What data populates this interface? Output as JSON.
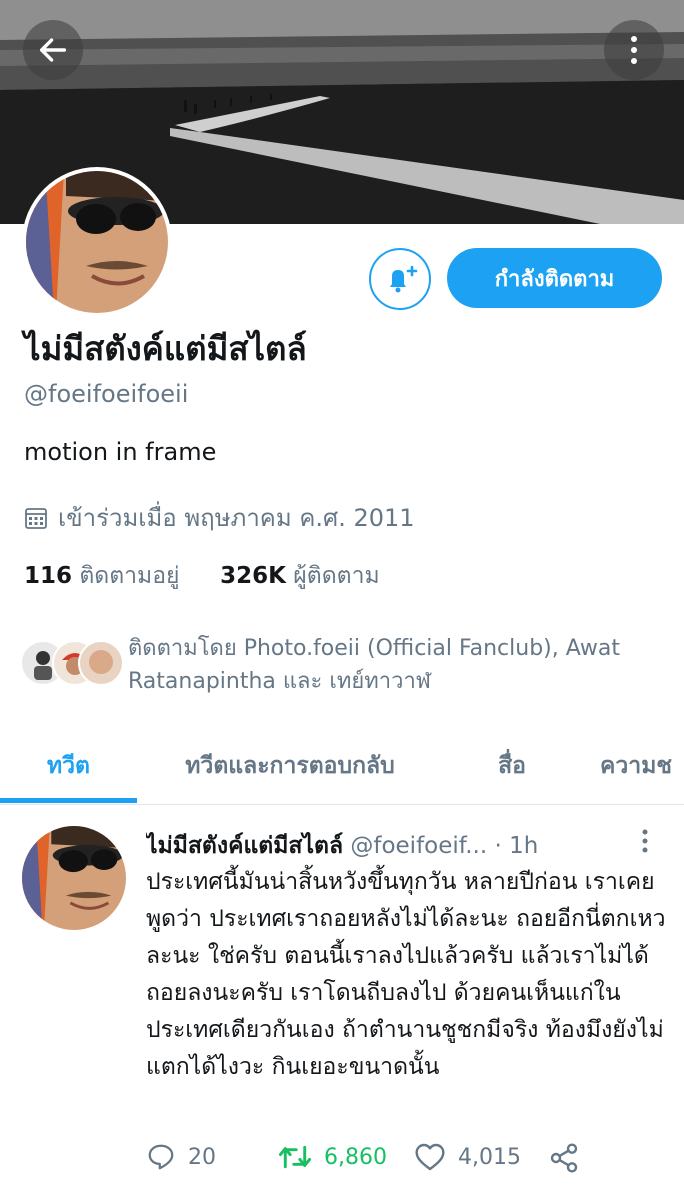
{
  "profile": {
    "name": "ไม่มีสตังค์แต่มีสไตล์",
    "handle": "@foeifoeifoeii",
    "bio": "motion in frame",
    "joined": "เข้าร่วมเมื่อ พฤษภาคม ค.ศ. 2011",
    "following_count": "116",
    "following_label": "ติดตามอยู่",
    "followers_count": "326K",
    "followers_label": "ผู้ติดตาม",
    "followed_by": "ติดตามโดย Photo.foeii (Official Fanclub), Awat Ratanapintha และ เทย์ทาวาฬ"
  },
  "header": {
    "back_icon": "arrow-left-icon",
    "more_icon": "more-vertical-icon",
    "bell_icon": "bell-plus-icon",
    "follow_label": "กำลังติดตาม"
  },
  "tabs": [
    {
      "label": "ทวีต",
      "active": true
    },
    {
      "label": "ทวีตและการตอบกลับ",
      "active": false
    },
    {
      "label": "สื่อ",
      "active": false
    },
    {
      "label": "ความช",
      "active": false
    }
  ],
  "tweet": {
    "name": "ไม่มีสตังค์แต่มีสไตล์",
    "handle": "@foeifoeif...",
    "time": "· 1h",
    "text": "ประเทศนี้มันน่าสิ้นหวังขึ้นทุกวัน หลายปีก่อน เราเคยพูดว่า ประเทศเราถอยหลังไม่ได้ละนะ ถอยอีกนี่ตกเหวละนะ ใช่ครับ ตอนนี้เราลงไปแล้วครับ แล้วเราไม่ได้ถอยลงนะครับ เราโดนถีบลงไป ด้วยคนเห็นแก่ในประเทศเดียวกันเอง ถ้าตำนานชูชกมีจริง ท้องมึงยังไม่แตกได้ไงวะ กินเยอะขนาดนั้น",
    "replies": "20",
    "retweets": "6,860",
    "likes": "4,015"
  },
  "colors": {
    "accent": "#1da1f2",
    "retweet_green": "#17bf63",
    "secondary_text": "#657786"
  }
}
